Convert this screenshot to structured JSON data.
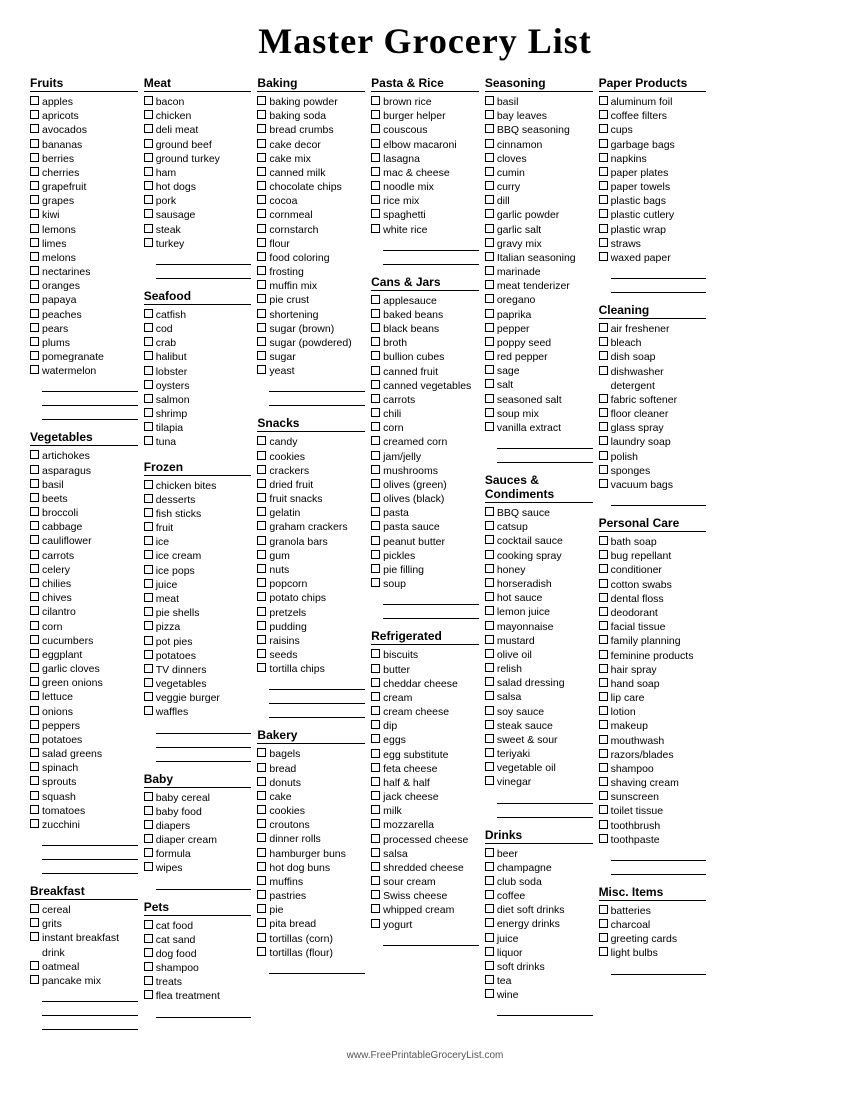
{
  "title": "Master Grocery List",
  "footer": "www.FreePrintableGroceryList.com",
  "columns": [
    {
      "sections": [
        {
          "title": "Fruits",
          "items": [
            "apples",
            "apricots",
            "avocados",
            "bananas",
            "berries",
            "cherries",
            "grapefruit",
            "grapes",
            "kiwi",
            "lemons",
            "limes",
            "melons",
            "nectarines",
            "oranges",
            "papaya",
            "peaches",
            "pears",
            "plums",
            "pomegranate",
            "watermelon",
            "___",
            "___",
            "___"
          ]
        },
        {
          "title": "Vegetables",
          "items": [
            "artichokes",
            "asparagus",
            "basil",
            "beets",
            "broccoli",
            "cabbage",
            "cauliflower",
            "carrots",
            "celery",
            "chilies",
            "chives",
            "cilantro",
            "corn",
            "cucumbers",
            "eggplant",
            "garlic cloves",
            "green onions",
            "lettuce",
            "onions",
            "peppers",
            "potatoes",
            "salad greens",
            "spinach",
            "sprouts",
            "squash",
            "tomatoes",
            "zucchini",
            "___",
            "___",
            "___"
          ]
        },
        {
          "title": "Breakfast",
          "items": [
            "cereal",
            "grits",
            "instant breakfast drink",
            "oatmeal",
            "pancake mix",
            "___",
            "___",
            "___"
          ]
        }
      ]
    },
    {
      "sections": [
        {
          "title": "Meat",
          "items": [
            "bacon",
            "chicken",
            "deli meat",
            "ground beef",
            "ground turkey",
            "ham",
            "hot dogs",
            "pork",
            "sausage",
            "steak",
            "turkey",
            "___",
            "___"
          ]
        },
        {
          "title": "Seafood",
          "items": [
            "catfish",
            "cod",
            "crab",
            "halibut",
            "lobster",
            "oysters",
            "salmon",
            "shrimp",
            "tilapia",
            "tuna"
          ]
        },
        {
          "title": "Frozen",
          "items": [
            "chicken bites",
            "desserts",
            "fish sticks",
            "fruit",
            "ice",
            "ice cream",
            "ice pops",
            "juice",
            "meat",
            "pie shells",
            "pizza",
            "pot pies",
            "potatoes",
            "TV dinners",
            "vegetables",
            "veggie burger",
            "waffles",
            "___",
            "___",
            "___"
          ]
        },
        {
          "title": "Baby",
          "items": [
            "baby cereal",
            "baby food",
            "diapers",
            "diaper cream",
            "formula",
            "wipes",
            "___"
          ]
        },
        {
          "title": "Pets",
          "items": [
            "cat food",
            "cat sand",
            "dog food",
            "shampoo",
            "treats",
            "flea treatment",
            "___"
          ]
        }
      ]
    },
    {
      "sections": [
        {
          "title": "Baking",
          "items": [
            "baking powder",
            "baking soda",
            "bread crumbs",
            "cake decor",
            "cake mix",
            "canned milk",
            "chocolate chips",
            "cocoa",
            "cornmeal",
            "cornstarch",
            "flour",
            "food coloring",
            "frosting",
            "muffin mix",
            "pie crust",
            "shortening",
            "sugar (brown)",
            "sugar (powdered)",
            "sugar",
            "yeast",
            "___",
            "___"
          ]
        },
        {
          "title": "Snacks",
          "items": [
            "candy",
            "cookies",
            "crackers",
            "dried fruit",
            "fruit snacks",
            "gelatin",
            "graham crackers",
            "granola bars",
            "gum",
            "nuts",
            "popcorn",
            "potato chips",
            "pretzels",
            "pudding",
            "raisins",
            "seeds",
            "tortilla chips",
            "___",
            "___",
            "___"
          ]
        },
        {
          "title": "Bakery",
          "items": [
            "bagels",
            "bread",
            "donuts",
            "cake",
            "cookies",
            "croutons",
            "dinner rolls",
            "hamburger buns",
            "hot dog buns",
            "muffins",
            "pastries",
            "pie",
            "pita bread",
            "tortillas (corn)",
            "tortillas (flour)",
            "___"
          ]
        }
      ]
    },
    {
      "sections": [
        {
          "title": "Pasta & Rice",
          "items": [
            "brown rice",
            "burger helper",
            "couscous",
            "elbow macaroni",
            "lasagna",
            "mac & cheese",
            "noodle mix",
            "rice mix",
            "spaghetti",
            "white rice",
            "___",
            "___"
          ]
        },
        {
          "title": "Cans & Jars",
          "items": [
            "applesauce",
            "baked beans",
            "black beans",
            "broth",
            "bullion cubes",
            "canned fruit",
            "canned vegetables",
            "carrots",
            "chili",
            "corn",
            "creamed corn",
            "jam/jelly",
            "mushrooms",
            "olives (green)",
            "olives (black)",
            "pasta",
            "pasta sauce",
            "peanut butter",
            "pickles",
            "pie filling",
            "soup",
            "___",
            "___"
          ]
        },
        {
          "title": "Refrigerated",
          "items": [
            "biscuits",
            "butter",
            "cheddar cheese",
            "cream",
            "cream cheese",
            "dip",
            "eggs",
            "egg substitute",
            "feta cheese",
            "half & half",
            "jack cheese",
            "milk",
            "mozzarella",
            "processed cheese",
            "salsa",
            "shredded cheese",
            "sour cream",
            "Swiss cheese",
            "whipped cream",
            "yogurt",
            "___"
          ]
        }
      ]
    },
    {
      "sections": [
        {
          "title": "Seasoning",
          "items": [
            "basil",
            "bay leaves",
            "BBQ seasoning",
            "cinnamon",
            "cloves",
            "cumin",
            "curry",
            "dill",
            "garlic powder",
            "garlic salt",
            "gravy mix",
            "Italian seasoning",
            "marinade",
            "meat tenderizer",
            "oregano",
            "paprika",
            "pepper",
            "poppy seed",
            "red pepper",
            "sage",
            "salt",
            "seasoned salt",
            "soup mix",
            "vanilla extract",
            "___",
            "___"
          ]
        },
        {
          "title": "Sauces & Condiments",
          "items": [
            "BBQ sauce",
            "catsup",
            "cocktail sauce",
            "cooking spray",
            "honey",
            "horseradish",
            "hot sauce",
            "lemon juice",
            "mayonnaise",
            "mustard",
            "olive oil",
            "relish",
            "salad dressing",
            "salsa",
            "soy sauce",
            "steak sauce",
            "sweet & sour",
            "teriyaki",
            "vegetable oil",
            "vinegar",
            "___",
            "___"
          ]
        },
        {
          "title": "Drinks",
          "items": [
            "beer",
            "champagne",
            "club soda",
            "coffee",
            "diet soft drinks",
            "energy drinks",
            "juice",
            "liquor",
            "soft drinks",
            "tea",
            "wine",
            "___"
          ]
        }
      ]
    },
    {
      "sections": [
        {
          "title": "Paper Products",
          "items": [
            "aluminum foil",
            "coffee filters",
            "cups",
            "garbage bags",
            "napkins",
            "paper plates",
            "paper towels",
            "plastic bags",
            "plastic cutlery",
            "plastic wrap",
            "straws",
            "waxed paper",
            "___",
            "___"
          ]
        },
        {
          "title": "Cleaning",
          "items": [
            "air freshener",
            "bleach",
            "dish soap",
            "dishwasher detergent",
            "fabric softener",
            "floor cleaner",
            "glass spray",
            "laundry soap",
            "polish",
            "sponges",
            "vacuum bags",
            "___"
          ]
        },
        {
          "title": "Personal Care",
          "items": [
            "bath soap",
            "bug repellant",
            "conditioner",
            "cotton swabs",
            "dental floss",
            "deodorant",
            "facial tissue",
            "family planning",
            "feminine products",
            "hair spray",
            "hand soap",
            "lip care",
            "lotion",
            "makeup",
            "mouthwash",
            "razors/blades",
            "shampoo",
            "shaving cream",
            "sunscreen",
            "toilet tissue",
            "toothbrush",
            "toothpaste",
            "___",
            "___"
          ]
        },
        {
          "title": "Misc. Items",
          "items": [
            "batteries",
            "charcoal",
            "greeting cards",
            "light bulbs",
            "___"
          ]
        }
      ]
    }
  ]
}
